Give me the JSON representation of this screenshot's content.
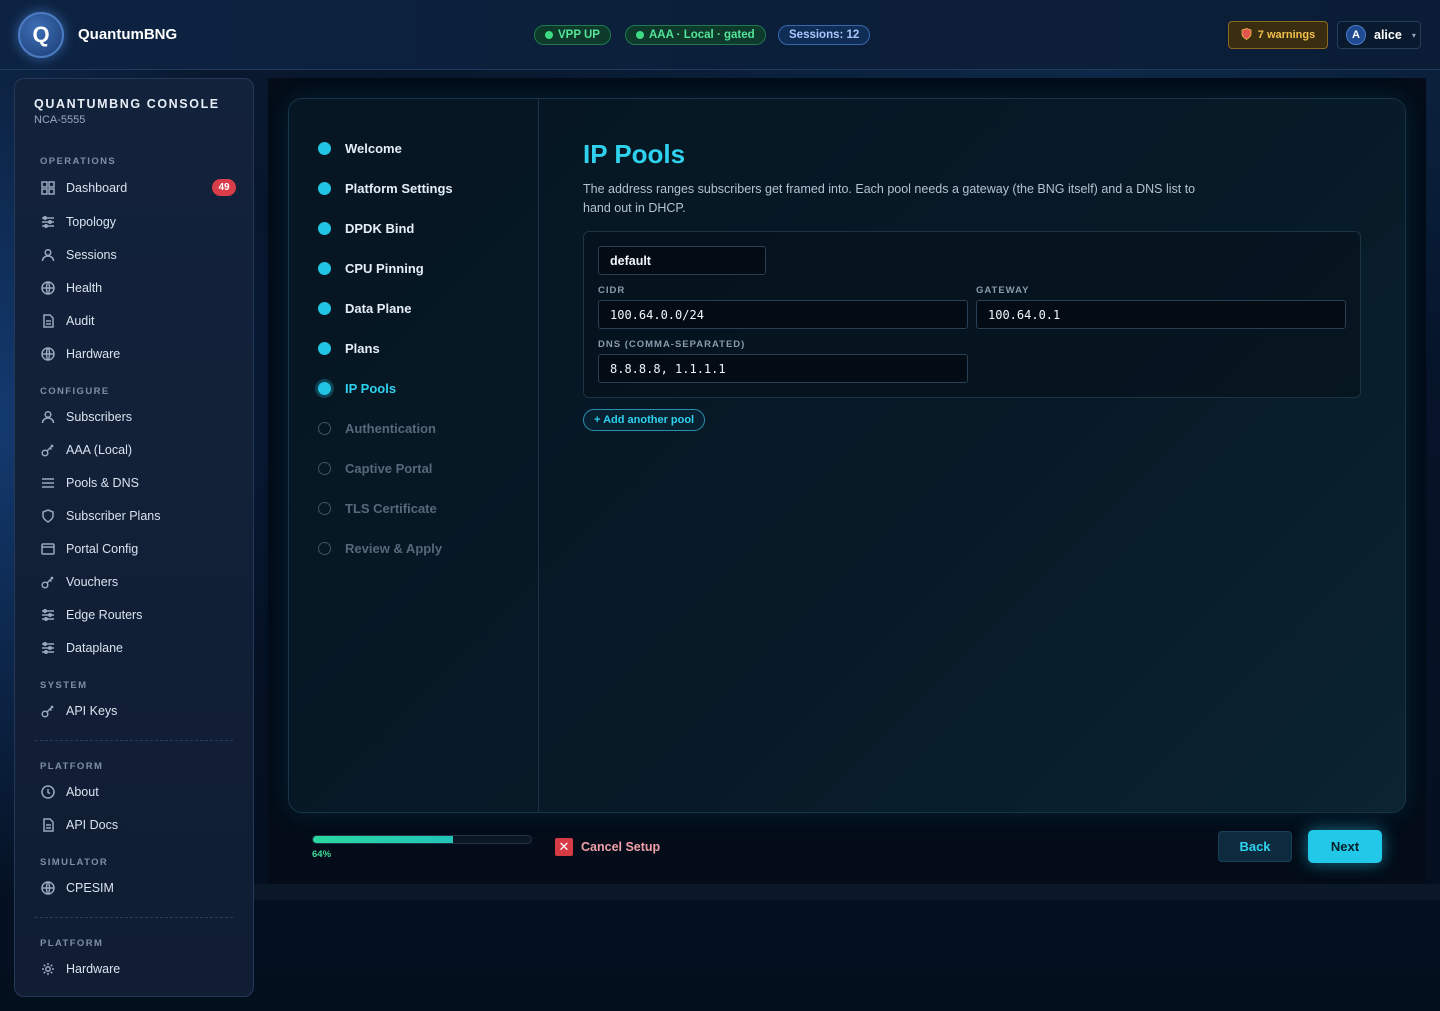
{
  "header": {
    "logo_letter": "Q",
    "brand": "QuantumBNG",
    "status_vpp": "VPP UP",
    "status_aaa": "AAA · Local · gated",
    "sessions": "Sessions: 12",
    "warnings": "7 warnings",
    "user_initial": "A",
    "user_name": "alice"
  },
  "sidebar": {
    "title": "QUANTUMBNG CONSOLE",
    "subtitle": "NCA-5555",
    "sections": {
      "operations": "OPERATIONS",
      "configure": "CONFIGURE",
      "system": "SYSTEM",
      "platform": "PLATFORM",
      "simulator": "SIMULATOR",
      "platform2": "PLATFORM"
    },
    "items": {
      "dashboard": "Dashboard",
      "dashboard_badge": "49",
      "topology": "Topology",
      "sessions": "Sessions",
      "health": "Health",
      "audit": "Audit",
      "hardware": "Hardware",
      "subscribers": "Subscribers",
      "aaa_local": "AAA (Local)",
      "pools_dns": "Pools & DNS",
      "subscriber_plans": "Subscriber Plans",
      "portal_config": "Portal Config",
      "vouchers": "Vouchers",
      "edge_routers": "Edge Routers",
      "dataplane": "Dataplane",
      "api_keys": "API Keys",
      "about": "About",
      "api_docs": "API Docs",
      "cpesim": "CPESIM",
      "hardware2": "Hardware"
    }
  },
  "wizard": {
    "steps": [
      {
        "label": "Welcome",
        "state": "done"
      },
      {
        "label": "Platform Settings",
        "state": "done"
      },
      {
        "label": "DPDK Bind",
        "state": "done"
      },
      {
        "label": "CPU Pinning",
        "state": "done"
      },
      {
        "label": "Data Plane",
        "state": "done"
      },
      {
        "label": "Plans",
        "state": "done"
      },
      {
        "label": "IP Pools",
        "state": "active"
      },
      {
        "label": "Authentication",
        "state": "todo"
      },
      {
        "label": "Captive Portal",
        "state": "todo"
      },
      {
        "label": "TLS Certificate",
        "state": "todo"
      },
      {
        "label": "Review & Apply",
        "state": "todo"
      }
    ],
    "title": "IP Pools",
    "description": "The address ranges subscribers get framed into. Each pool needs a gateway (the BNG itself) and a DNS list to hand out in DHCP.",
    "pool": {
      "name": "default",
      "cidr_label": "CIDR",
      "cidr": "100.64.0.0/24",
      "gateway_label": "GATEWAY",
      "gateway": "100.64.0.1",
      "dns_label": "DNS (COMMA-SEPARATED)",
      "dns": "8.8.8.8, 1.1.1.1"
    },
    "add_pool": "+ Add another pool",
    "progress_percent": 64,
    "progress_label": "64%",
    "cancel": "Cancel Setup",
    "back": "Back",
    "next": "Next"
  },
  "colors": {
    "accent": "#22c8e8",
    "success": "#3ddc84",
    "danger": "#d93d4a",
    "warning": "#f2c14e"
  }
}
